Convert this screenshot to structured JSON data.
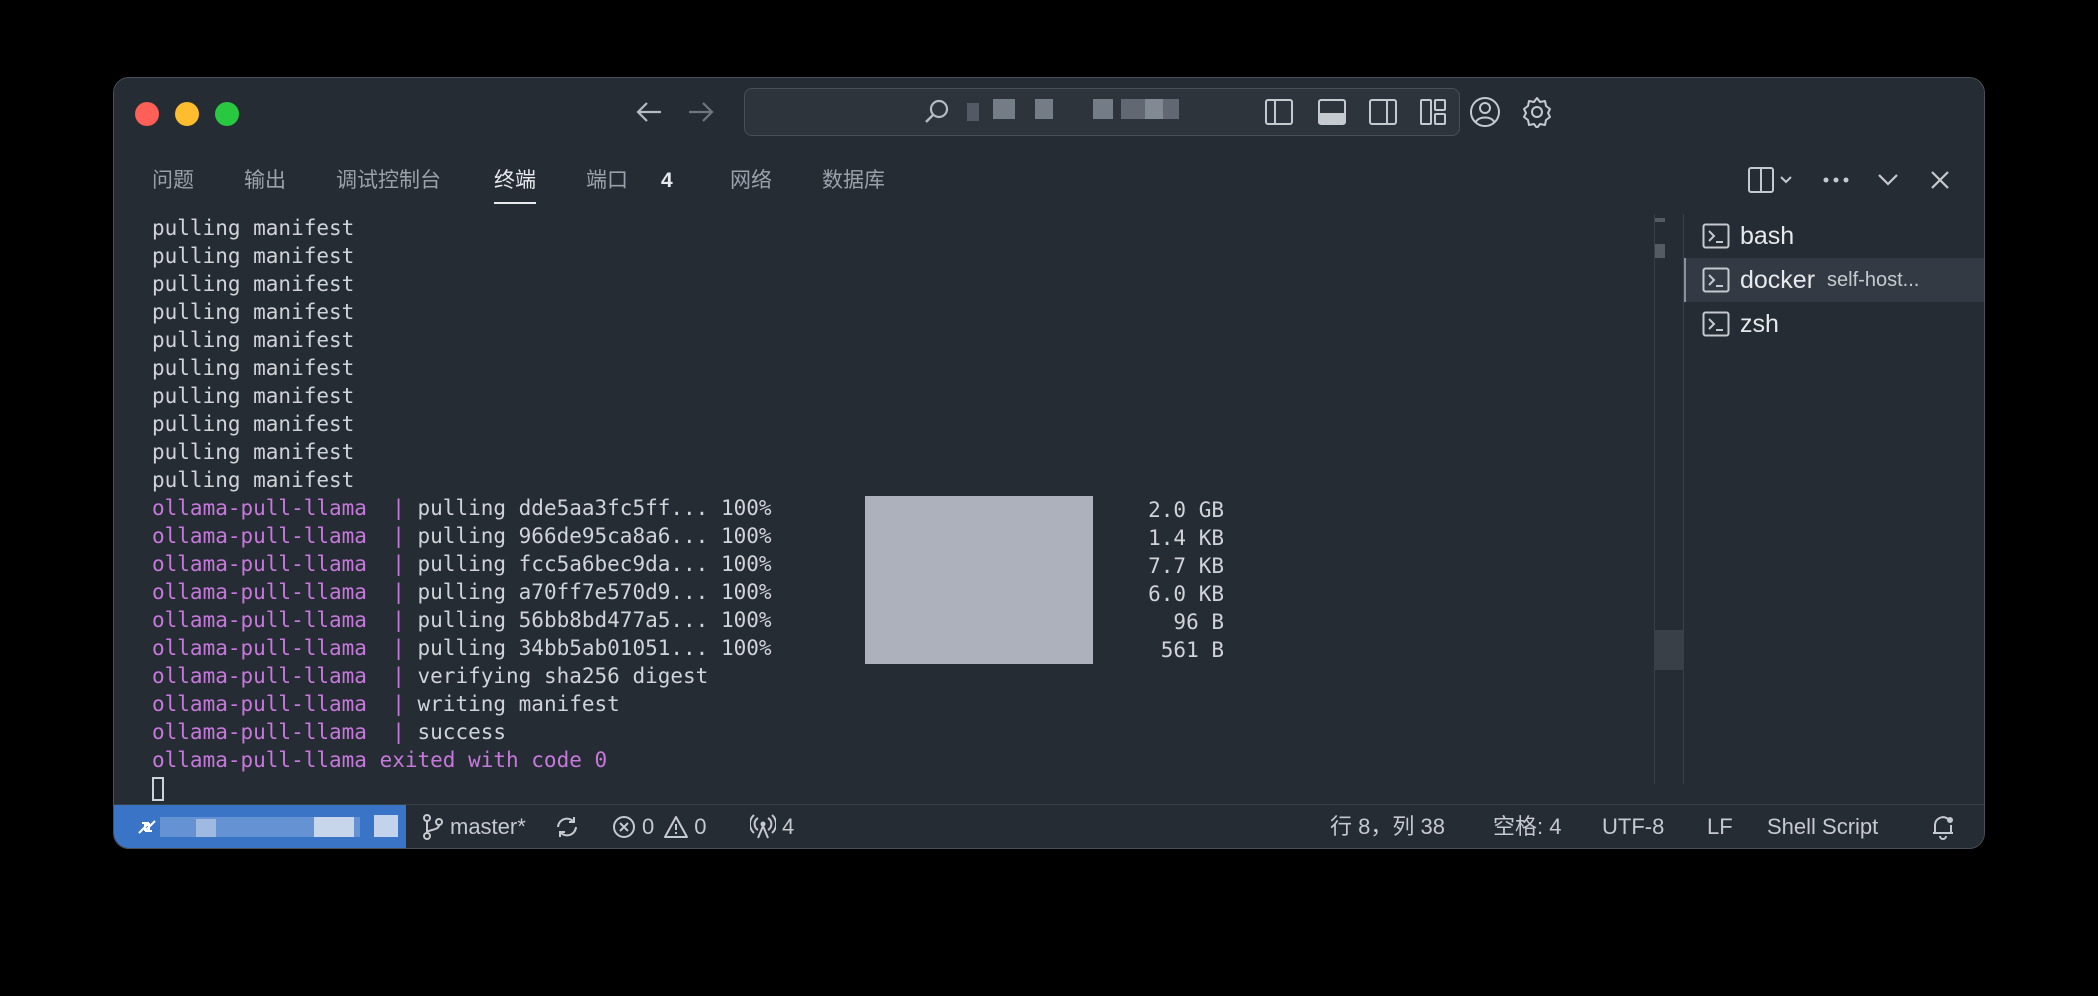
{
  "window": {
    "search_text": ""
  },
  "panel": {
    "tabs": [
      {
        "label": "问题"
      },
      {
        "label": "输出"
      },
      {
        "label": "调试控制台"
      },
      {
        "label": "终端"
      },
      {
        "label": "端口"
      },
      {
        "label": "网络"
      },
      {
        "label": "数据库"
      }
    ],
    "ports_badge": "4",
    "active_tab": "终端"
  },
  "terminal": {
    "manifest_lines": [
      "pulling manifest",
      "pulling manifest",
      "pulling manifest",
      "pulling manifest",
      "pulling manifest",
      "pulling manifest",
      "pulling manifest",
      "pulling manifest",
      "pulling manifest",
      "pulling manifest"
    ],
    "prefix": "ollama-pull-llama ",
    "sep": " | ",
    "pull_lines": [
      {
        "text": "pulling dde5aa3fc5ff... 100%",
        "size": "2.0 GB"
      },
      {
        "text": "pulling 966de95ca8a6... 100%",
        "size": "1.4 KB"
      },
      {
        "text": "pulling fcc5a6bec9da... 100%",
        "size": "7.7 KB"
      },
      {
        "text": "pulling a70ff7e570d9... 100%",
        "size": "6.0 KB"
      },
      {
        "text": "pulling 56bb8bd477a5... 100%",
        "size": "96 B"
      },
      {
        "text": "pulling 34bb5ab01051... 100%",
        "size": "561 B"
      }
    ],
    "tail_lines": [
      "verifying sha256 digest",
      "writing manifest",
      "success"
    ],
    "exit_line": "ollama-pull-llama exited with code 0",
    "progress": 1.0
  },
  "terminals": [
    {
      "name": "bash",
      "sub": ""
    },
    {
      "name": "docker",
      "sub": "self-host..."
    },
    {
      "name": "zsh",
      "sub": ""
    }
  ],
  "statusbar": {
    "branch": "master*",
    "errors": "0",
    "warnings": "0",
    "ports": "4",
    "position": "行 8，列 38",
    "spaces": "空格: 4",
    "encoding": "UTF-8",
    "eol": "LF",
    "language": "Shell Script"
  },
  "colors": {
    "accent": "#3974c6",
    "purple": "#c678dd",
    "background": "#262c33"
  }
}
